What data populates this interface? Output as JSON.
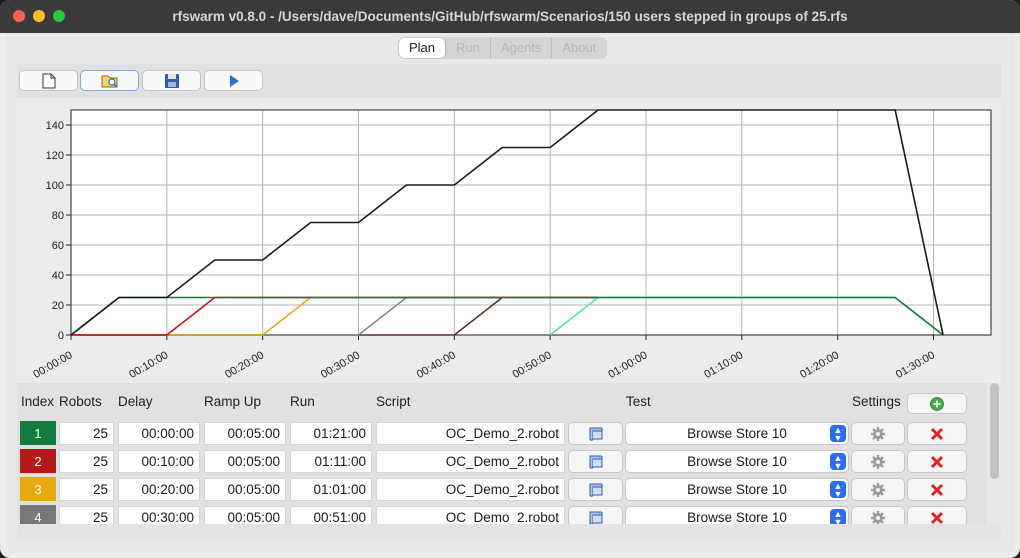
{
  "window": {
    "title": "rfswarm v0.8.0 - /Users/dave/Documents/GitHub/rfswarm/Scenarios/150 users stepped in groups of 25.rfs"
  },
  "tabs": [
    "Plan",
    "Run",
    "Agents",
    "About"
  ],
  "toolbar": {
    "buttons": [
      "new-file-icon",
      "open-folder-icon",
      "save-icon",
      "play-icon"
    ]
  },
  "headers": {
    "index": "Index",
    "robots": "Robots",
    "delay": "Delay",
    "rampup": "Ramp Up",
    "run": "Run",
    "script": "Script",
    "test": "Test",
    "settings": "Settings"
  },
  "rows": [
    {
      "index": "1",
      "color": "#137b3c",
      "robots": "25",
      "delay": "00:00:00",
      "rampup": "00:05:00",
      "run": "01:21:00",
      "script": "OC_Demo_2.robot",
      "test": "Browse Store 10"
    },
    {
      "index": "2",
      "color": "#b51818",
      "robots": "25",
      "delay": "00:10:00",
      "rampup": "00:05:00",
      "run": "01:11:00",
      "script": "OC_Demo_2.robot",
      "test": "Browse Store 10"
    },
    {
      "index": "3",
      "color": "#e8a811",
      "robots": "25",
      "delay": "00:20:00",
      "rampup": "00:05:00",
      "run": "01:01:00",
      "script": "OC_Demo_2.robot",
      "test": "Browse Store 10"
    },
    {
      "index": "4",
      "color": "#777777",
      "robots": "25",
      "delay": "00:30:00",
      "rampup": "00:05:00",
      "run": "00:51:00",
      "script": "OC_Demo_2.robot",
      "test": "Browse Store 10"
    }
  ],
  "chart_data": {
    "type": "line",
    "x_unit": "minutes",
    "xlim": [
      0,
      96
    ],
    "ylim": [
      0,
      150
    ],
    "x_ticks": [
      0,
      10,
      20,
      30,
      40,
      50,
      60,
      70,
      80,
      90
    ],
    "x_tick_labels": [
      "00:00:00",
      "00:10:00",
      "00:20:00",
      "00:30:00",
      "00:40:00",
      "00:50:00",
      "01:00:00",
      "01:10:00",
      "01:20:00",
      "01:30:00"
    ],
    "y_ticks": [
      0,
      20,
      40,
      60,
      80,
      100,
      120,
      140
    ],
    "grid": true,
    "series": [
      {
        "color": "#1a1a1a",
        "points": [
          [
            0,
            0
          ],
          [
            5,
            25
          ],
          [
            10,
            25
          ],
          [
            15,
            50
          ],
          [
            20,
            50
          ],
          [
            25,
            75
          ],
          [
            30,
            75
          ],
          [
            35,
            100
          ],
          [
            40,
            100
          ],
          [
            45,
            125
          ],
          [
            50,
            125
          ],
          [
            55,
            150
          ],
          [
            86,
            150
          ],
          [
            91,
            0
          ]
        ]
      },
      {
        "color": "#137b3c",
        "points": [
          [
            0,
            0
          ],
          [
            5,
            25
          ],
          [
            86,
            25
          ],
          [
            91,
            0
          ]
        ]
      },
      {
        "color": "#b51818",
        "points": [
          [
            0,
            0
          ],
          [
            10,
            0
          ],
          [
            15,
            25
          ],
          [
            55,
            25
          ]
        ]
      },
      {
        "color": "#e8a811",
        "points": [
          [
            0,
            0
          ],
          [
            20,
            0
          ],
          [
            25,
            25
          ],
          [
            55,
            25
          ]
        ]
      },
      {
        "color": "#888888",
        "points": [
          [
            0,
            0
          ],
          [
            30,
            0
          ],
          [
            35,
            25
          ],
          [
            55,
            25
          ]
        ]
      },
      {
        "color": "#5b2d2d",
        "points": [
          [
            0,
            0
          ],
          [
            40,
            0
          ],
          [
            45,
            25
          ],
          [
            55,
            25
          ]
        ]
      },
      {
        "color": "#52e6a0",
        "points": [
          [
            50,
            0
          ],
          [
            55,
            25
          ],
          [
            86,
            25
          ],
          [
            91,
            0
          ]
        ]
      }
    ]
  }
}
